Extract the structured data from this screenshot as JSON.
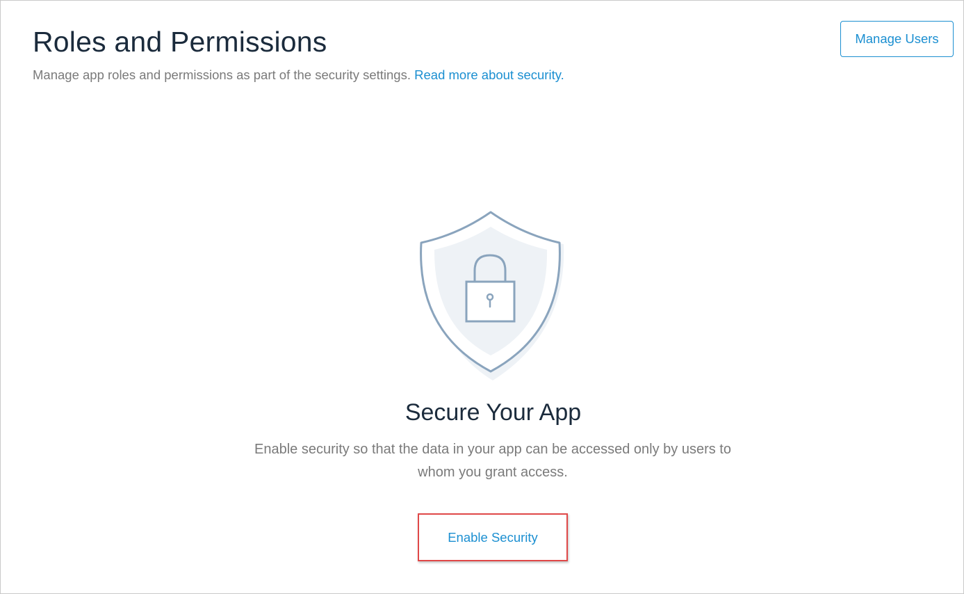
{
  "header": {
    "title": "Roles and Permissions",
    "subtitle": "Manage app roles and permissions as part of the security settings.",
    "read_more_link": "Read more about security.",
    "manage_users_label": "Manage Users"
  },
  "empty_state": {
    "icon": "shield-lock-icon",
    "title": "Secure Your App",
    "description": "Enable security so that the data in your app can be accessed only by users to whom you grant access.",
    "enable_button_label": "Enable Security"
  },
  "colors": {
    "accent": "#1b8fd1",
    "title_text": "#1b2b3c",
    "muted_text": "#7a7a7a",
    "highlight_border": "#e04848",
    "shield_stroke": "#8aa4bd",
    "shield_fill": "#eef2f6"
  }
}
